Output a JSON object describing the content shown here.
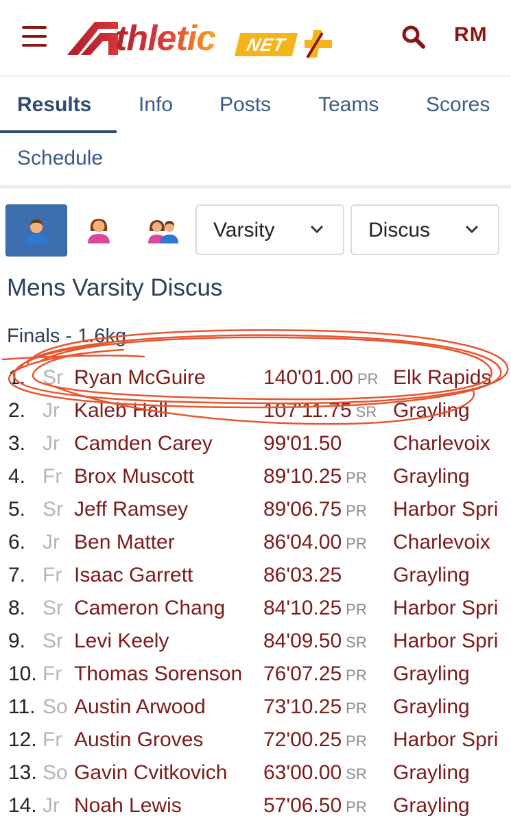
{
  "header": {
    "logo_text": "thletic",
    "logo_net": "NET",
    "user_initials": "RM",
    "colors": {
      "brand": "#8a1515",
      "accent": "#f4b41a"
    }
  },
  "tabs": [
    {
      "label": "Results",
      "active": true
    },
    {
      "label": "Info"
    },
    {
      "label": "Posts"
    },
    {
      "label": "Teams"
    },
    {
      "label": "Scores"
    },
    {
      "label": "Schedule"
    }
  ],
  "filters": {
    "gender_buttons": [
      {
        "icon": "male-athlete-icon",
        "active": true
      },
      {
        "icon": "female-athlete-icon",
        "active": false
      },
      {
        "icon": "mixed-athletes-icon",
        "active": false
      }
    ],
    "level_select": "Varsity",
    "event_select": "Discus"
  },
  "event_title": "Mens Varsity Discus",
  "round_title": "Finals - 1.6kg",
  "results": [
    {
      "place": "1.",
      "grade": "Sr",
      "name": "Ryan McGuire",
      "mark": "140'01.00",
      "record": "PR",
      "team": "Elk Rapids"
    },
    {
      "place": "2.",
      "grade": "Jr",
      "name": "Kaleb Hall",
      "mark": "107'11.75",
      "record": "SR",
      "team": "Grayling"
    },
    {
      "place": "3.",
      "grade": "Jr",
      "name": "Camden Carey",
      "mark": "99'01.50",
      "record": "",
      "team": "Charlevoix"
    },
    {
      "place": "4.",
      "grade": "Fr",
      "name": "Brox Muscott",
      "mark": "89'10.25",
      "record": "PR",
      "team": "Grayling"
    },
    {
      "place": "5.",
      "grade": "Sr",
      "name": "Jeff Ramsey",
      "mark": "89'06.75",
      "record": "PR",
      "team": "Harbor Spri"
    },
    {
      "place": "6.",
      "grade": "Jr",
      "name": "Ben Matter",
      "mark": "86'04.00",
      "record": "PR",
      "team": "Charlevoix"
    },
    {
      "place": "7.",
      "grade": "Fr",
      "name": "Isaac Garrett",
      "mark": "86'03.25",
      "record": "",
      "team": "Grayling"
    },
    {
      "place": "8.",
      "grade": "Sr",
      "name": "Cameron Chang",
      "mark": "84'10.25",
      "record": "PR",
      "team": "Harbor Spri"
    },
    {
      "place": "9.",
      "grade": "Sr",
      "name": "Levi Keely",
      "mark": "84'09.50",
      "record": "SR",
      "team": "Harbor Spri"
    },
    {
      "place": "10.",
      "grade": "Fr",
      "name": "Thomas Sorenson",
      "mark": "76'07.25",
      "record": "PR",
      "team": "Grayling"
    },
    {
      "place": "11.",
      "grade": "So",
      "name": "Austin Arwood",
      "mark": "73'10.25",
      "record": "PR",
      "team": "Grayling"
    },
    {
      "place": "12.",
      "grade": "Fr",
      "name": "Austin Groves",
      "mark": "72'00.25",
      "record": "PR",
      "team": "Harbor Spri"
    },
    {
      "place": "13.",
      "grade": "So",
      "name": "Gavin Cvitkovich",
      "mark": "63'00.00",
      "record": "SR",
      "team": "Grayling"
    },
    {
      "place": "14.",
      "grade": "Jr",
      "name": "Noah Lewis",
      "mark": "57'06.50",
      "record": "PR",
      "team": "Grayling"
    }
  ],
  "annotation": {
    "type": "hand-drawn-circle",
    "color": "#e8552f",
    "highlights_row": 1
  }
}
